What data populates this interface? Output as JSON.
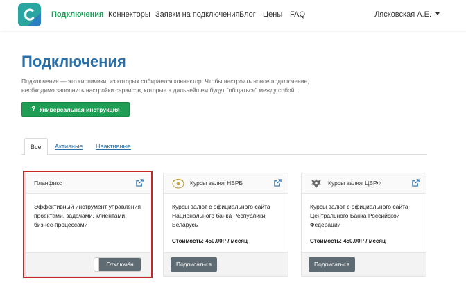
{
  "nav": {
    "items": [
      "Подключения",
      "Коннекторы",
      "Заявки на подключения",
      "Блог",
      "Цены",
      "FAQ"
    ],
    "user": "Лясковская А.Е."
  },
  "header": {
    "title": "Подключения",
    "description": "Подключения — это кирпичики, из которых собирается коннектор. Чтобы настроить новое подключение, необходимо заполнить настройки сервисов, которые в дальнейшем будут \"общаться\" между собой.",
    "guide_button": "Универсальная инструкция"
  },
  "tabs": [
    "Все",
    "Активные",
    "Неактивные"
  ],
  "cards": [
    {
      "title": "Планфикс",
      "description": "Эффективный инструмент управления проектами, задачами, клиентами, бизнес-процессами",
      "toggle_label": "Отключён"
    },
    {
      "title": "Курсы валют НБРБ",
      "description": "Курсы валют с официального сайта Национального банка Республики Беларусь",
      "price": "Стоимость: 450.00Р / месяц",
      "button": "Подписаться"
    },
    {
      "title": "Курсы валют ЦБРФ",
      "description": "Курсы валют с официального сайта Центрального Банка Российской Федерации",
      "price": "Стоимость: 450.00Р / месяц",
      "button": "Подписаться"
    }
  ],
  "colors": {
    "brand_green": "#1f9d55",
    "title_blue": "#2b6fa8",
    "button_gray": "#5f6b73",
    "highlight_red": "#c7252c"
  }
}
